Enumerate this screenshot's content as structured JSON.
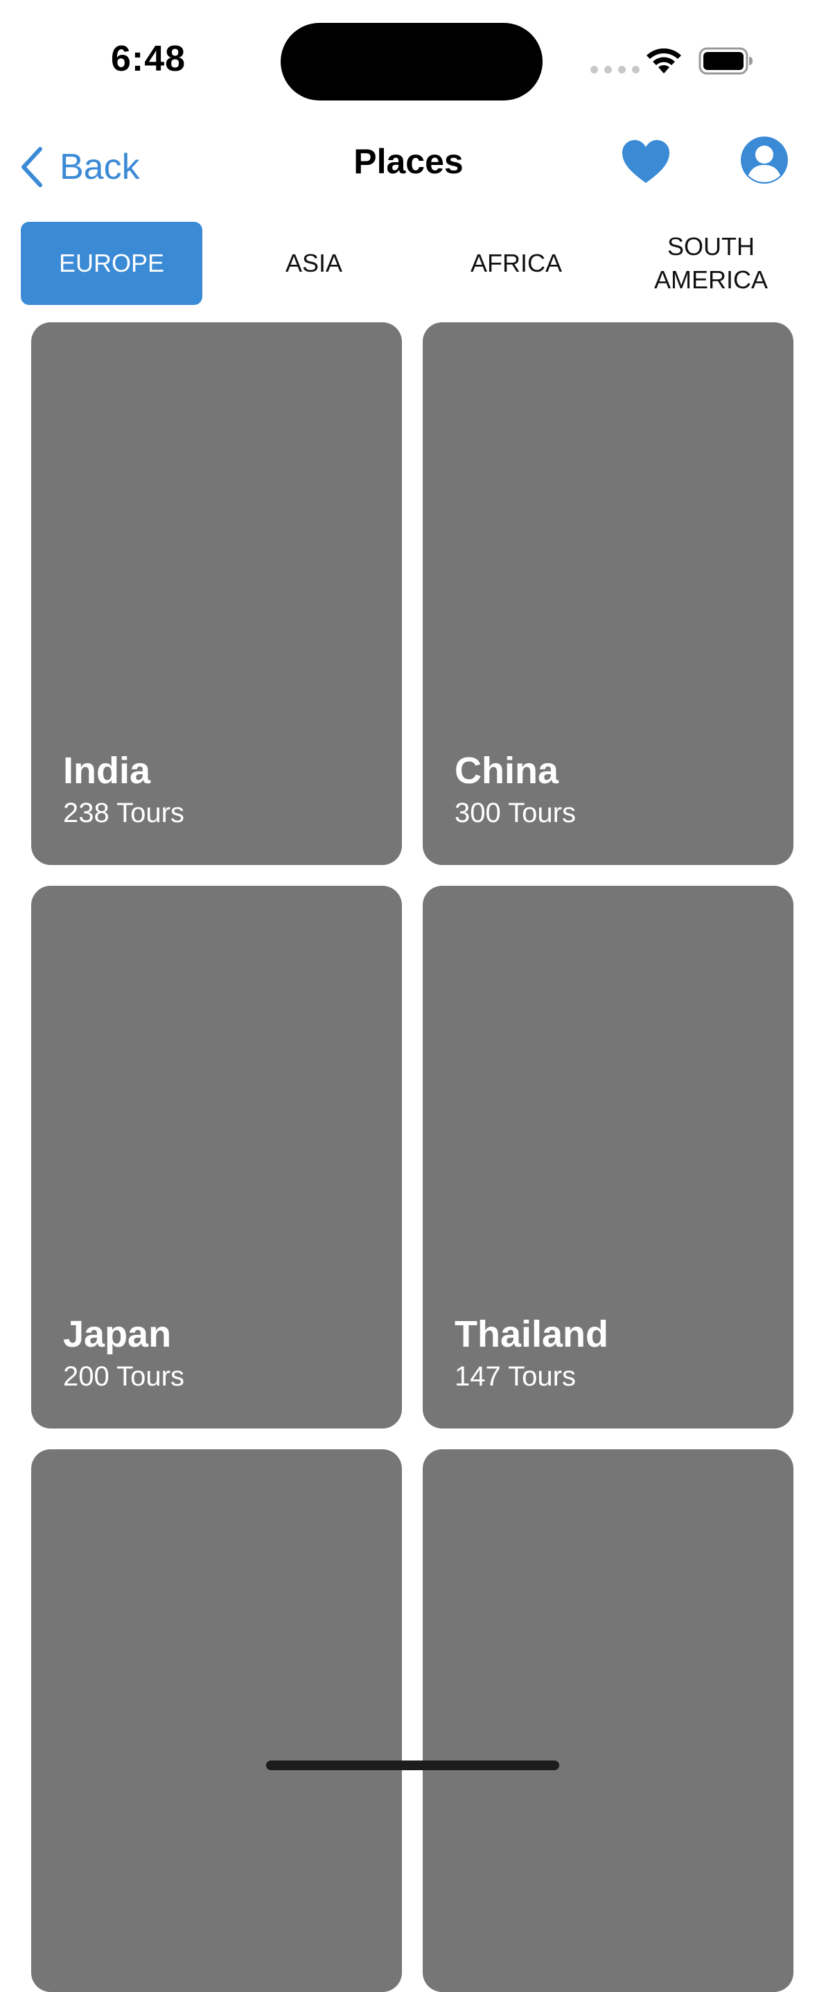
{
  "status": {
    "time": "6:48"
  },
  "nav": {
    "back_label": "Back",
    "title": "Places"
  },
  "tabs": [
    {
      "label": "EUROPE",
      "active": true
    },
    {
      "label": "ASIA",
      "active": false
    },
    {
      "label": "AFRICA",
      "active": false
    },
    {
      "label": "SOUTH AMERICA",
      "active": false
    }
  ],
  "places": [
    {
      "name": "India",
      "tours": "238 Tours"
    },
    {
      "name": "China",
      "tours": "300 Tours"
    },
    {
      "name": "Japan",
      "tours": "200 Tours"
    },
    {
      "name": "Thailand",
      "tours": "147 Tours"
    },
    {
      "name": "",
      "tours": ""
    },
    {
      "name": "",
      "tours": ""
    }
  ],
  "colors": {
    "accent": "#3a8ad6",
    "card": "#767676"
  },
  "icons": {
    "back": "chevron-left-icon",
    "favorite": "heart-icon",
    "profile": "person-circle-icon",
    "wifi": "wifi-icon",
    "battery": "battery-icon"
  }
}
